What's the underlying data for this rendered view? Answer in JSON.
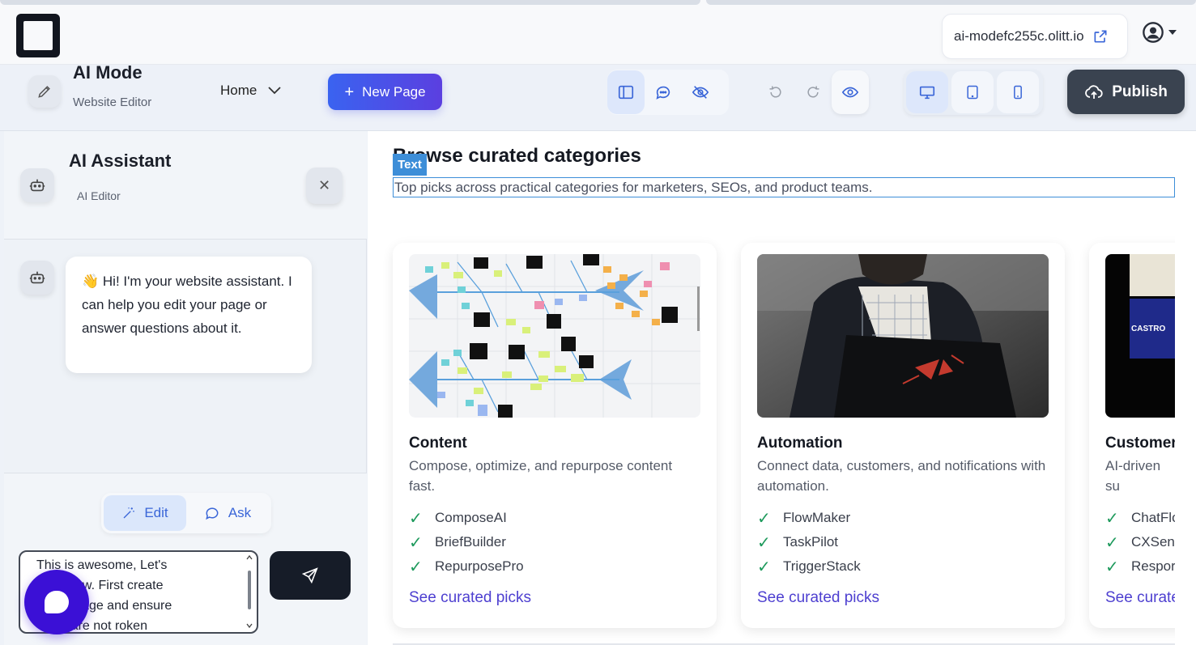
{
  "browser": {
    "url": "ai-modefc255c.olitt.io"
  },
  "toolbar": {
    "mode_title": "AI Mode",
    "mode_subtitle": "Website Editor",
    "page_select": "Home",
    "new_page_label": "New Page",
    "publish_label": "Publish"
  },
  "assistant": {
    "title": "AI Assistant",
    "subtitle": "AI Editor",
    "greeting_emoji": "👋",
    "greeting": "Hi! I'm your website assistant. I can help you edit your page or answer questions about it.",
    "edit_label": "Edit",
    "ask_label": "Ask",
    "input_value": "This is awesome, Let's\n   e it now. First create\n   sing page and ensure\n   nks are not roken"
  },
  "canvas": {
    "section_title": "Browse curated categories",
    "text_tag": "Text",
    "section_subtitle": "Top picks across practical categories for marketers, SEOs, and product teams.",
    "cards": [
      {
        "title": "Content",
        "description": "Compose, optimize, and repurpose content fast.",
        "items": [
          "ComposeAI",
          "BriefBuilder",
          "RepurposePro"
        ],
        "link": "See curated picks"
      },
      {
        "title": "Automation",
        "description": "Connect data, customers, and notifications with automation.",
        "items": [
          "FlowMaker",
          "TaskPilot",
          "TriggerStack"
        ],
        "link": "See curated picks"
      },
      {
        "title": "Customer",
        "description": "AI-driven su customers.",
        "items": [
          "ChatFlo",
          "CXSens",
          "Respor"
        ],
        "link": "See curate"
      }
    ],
    "third_card_image_text": "CASTRO"
  },
  "colors": {
    "accent_blue": "#3d8ed8",
    "new_page_gradient_start": "#3a63f0",
    "new_page_gradient_end": "#5b3fe0",
    "publish_bg": "#3a4350",
    "link_purple": "#4d3fd0",
    "check_green": "#1e9a5c",
    "fab_purple": "#3b10d6"
  },
  "icons": {
    "logo": "square-logo-icon",
    "external": "external-link-icon",
    "user": "user-circle-icon",
    "pen": "pen-icon",
    "sidebar": "sidebar-layout-icon",
    "comment": "comment-icon",
    "hidden": "eye-off-icon",
    "undo": "undo-icon",
    "redo": "redo-icon",
    "preview": "eye-icon",
    "desktop": "desktop-icon",
    "tablet": "tablet-icon",
    "mobile": "mobile-icon",
    "publish": "cloud-upload-icon",
    "bot": "robot-icon",
    "close": "close-icon",
    "magic": "magic-wand-icon",
    "ask": "chat-bubble-icon",
    "send": "send-icon",
    "fab": "chat-fab-icon"
  }
}
